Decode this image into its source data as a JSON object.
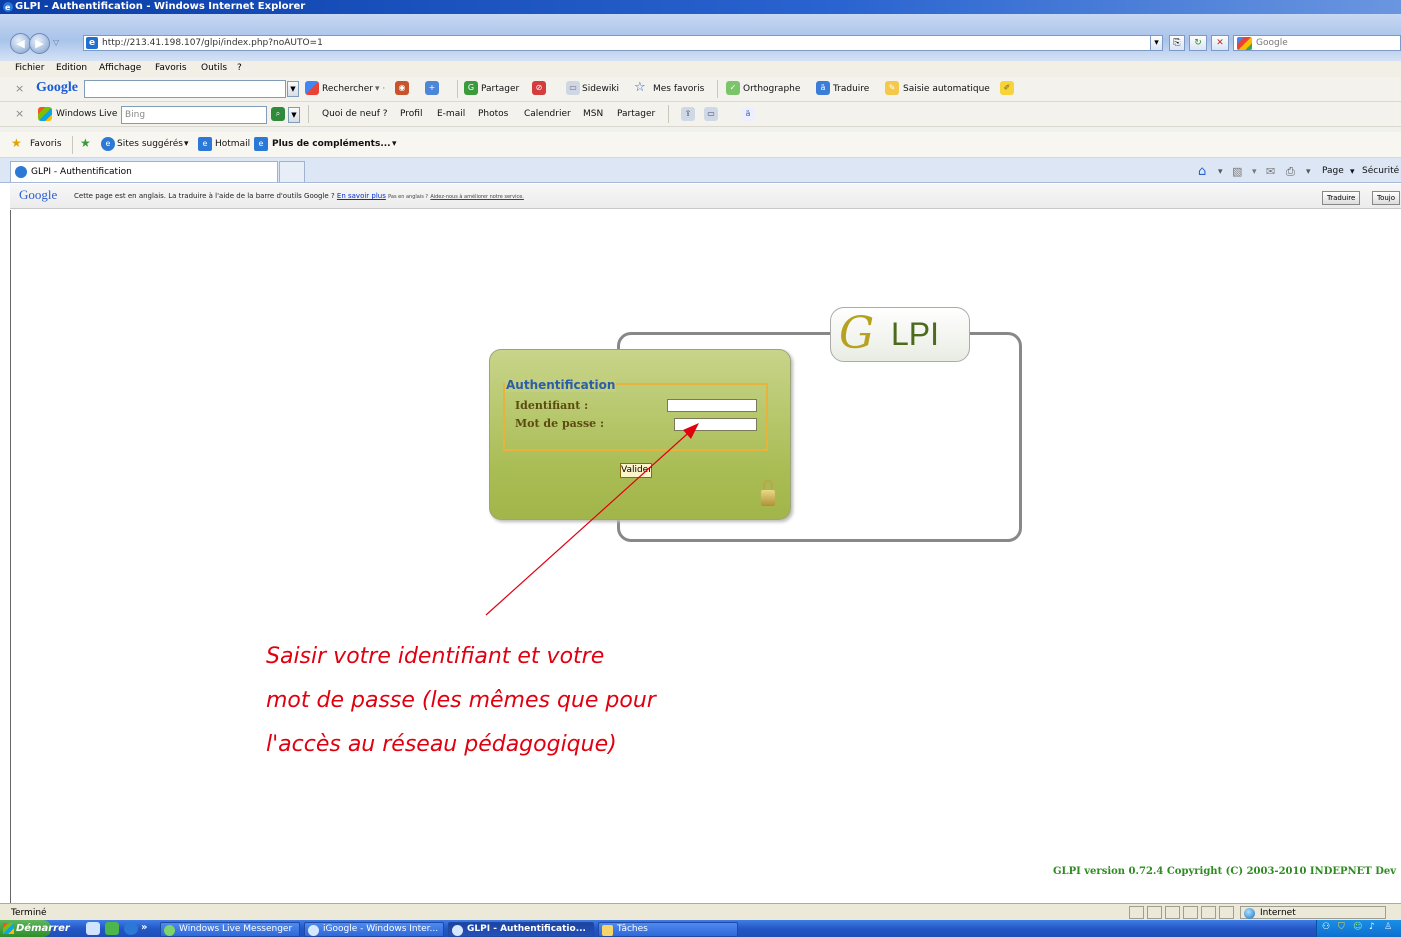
{
  "window": {
    "title": "GLPI - Authentification - Windows Internet Explorer"
  },
  "address_bar": {
    "url": "http://213.41.198.107/glpi/index.php?noAUTO=1",
    "search_placeholder": "Google"
  },
  "menu": [
    "Fichier",
    "Edition",
    "Affichage",
    "Favoris",
    "Outils",
    "?"
  ],
  "google_toolbar": {
    "logo": "Google",
    "search_label": "Rechercher",
    "share_label": "Partager",
    "sidewiki_label": "Sidewiki",
    "favorites_label": "Mes favoris",
    "spelling_label": "Orthographe",
    "translate_label": "Traduire",
    "autofill_label": "Saisie automatique"
  },
  "live_toolbar": {
    "brand": "Windows Live",
    "search_placeholder": "Bing",
    "links": [
      "Quoi de neuf ?",
      "Profil",
      "E-mail",
      "Photos",
      "Calendrier",
      "MSN",
      "Partager"
    ]
  },
  "favorites_bar": {
    "favorites_label": "Favoris",
    "items": [
      "Sites suggérés",
      "Hotmail",
      "Plus de compléments..."
    ]
  },
  "tabs": [
    {
      "label": "GLPI - Authentification"
    }
  ],
  "command_bar": {
    "page_label": "Page",
    "security_label": "Sécurité"
  },
  "translate_bar": {
    "logo": "Google",
    "message": "Cette page est en anglais. La traduire à l'aide de la barre d'outils Google ?",
    "learn_more": "En savoir plus",
    "not_english": "Pas en anglais ?",
    "help_improve": "Aidez-nous à améliorer notre service.",
    "translate_button": "Traduire",
    "always_button": "Toujo"
  },
  "login": {
    "logo_g": "G",
    "logo_text": "LPI",
    "legend": "Authentification",
    "username_label": "Identifiant :",
    "password_label": "Mot de passe :",
    "submit_label": "Valider"
  },
  "annotation": {
    "line1": "Saisir votre identifiant et votre",
    "line2": "mot de passe (les mêmes que pour",
    "line3": "l'accès au réseau pédagogique)"
  },
  "footer": {
    "version": "GLPI version 0.72.4 Copyright (C) 2003-2010 INDEPNET Dev"
  },
  "status_bar": {
    "status": "Terminé",
    "zone": "Internet"
  },
  "taskbar": {
    "start_label": "Démarrer",
    "buttons": [
      "Windows Live Messenger",
      "iGoogle - Windows Inter...",
      "GLPI - Authentificatio...",
      "Tâches"
    ]
  },
  "colors": {
    "annotation": "#e0000f",
    "footer_text": "#2f8a22",
    "legend": "#2b5ea8",
    "login_panel": "#a9bd55"
  }
}
